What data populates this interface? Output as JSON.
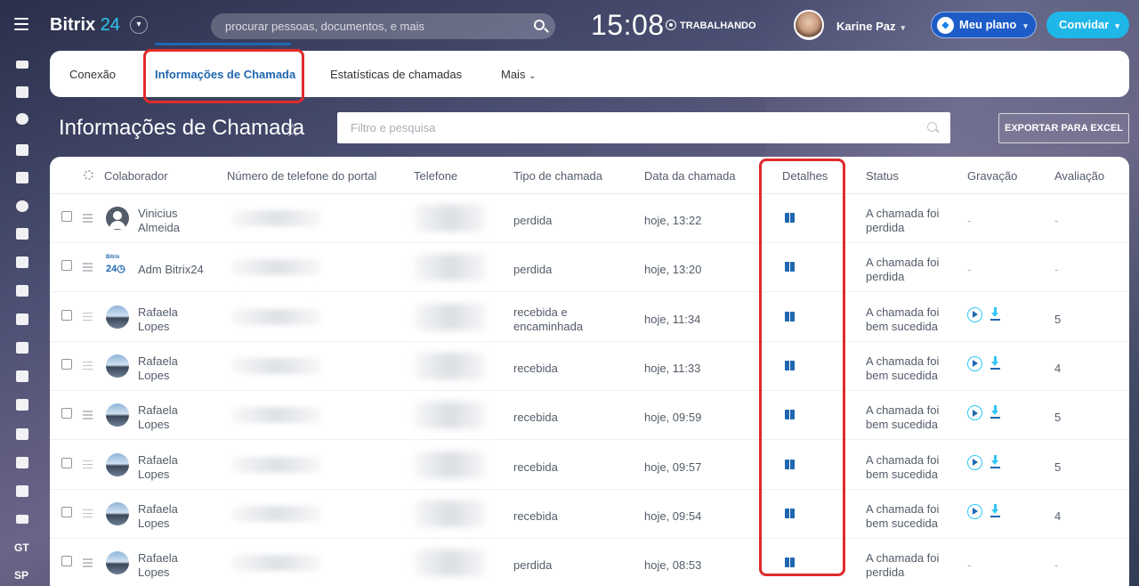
{
  "header": {
    "logo_name": "Bitrix",
    "logo_num": "24",
    "search_placeholder": "procurar pessoas, documentos, e mais",
    "time": "15:08",
    "work_status": "TRABALHANDO",
    "user_name": "Karine Paz",
    "plan_label": "Meu plano",
    "invite_label": "Convidar"
  },
  "sidebar": {
    "text_items": [
      "GT",
      "SP"
    ]
  },
  "tabs": [
    {
      "label": "Conexão",
      "active": false
    },
    {
      "label": "Informações de Chamada",
      "active": true
    },
    {
      "label": "Estatísticas de chamadas",
      "active": false
    },
    {
      "label": "Mais",
      "active": false
    }
  ],
  "page": {
    "title": "Informações de Chamada",
    "filter_placeholder": "Filtro e pesquisa",
    "export_label": "EXPORTAR PARA EXCEL"
  },
  "table": {
    "columns": [
      "Colaborador",
      "Número de telefone do portal",
      "Telefone",
      "Tipo de chamada",
      "Data da chamada",
      "Detalhes",
      "Status",
      "Gravação",
      "Avaliação"
    ],
    "rows": [
      {
        "name": [
          "Vinicius",
          "Almeida"
        ],
        "avatar": "default-user",
        "type": [
          "perdida"
        ],
        "date": "hoje, 13:22",
        "status": [
          "A chamada foi",
          "perdida"
        ],
        "recording": "-",
        "rating": "-"
      },
      {
        "name": [
          "Adm Bitrix24"
        ],
        "avatar": "bitrix-logo",
        "type": [
          "perdida"
        ],
        "date": "hoje, 13:20",
        "status": [
          "A chamada foi",
          "perdida"
        ],
        "recording": "-",
        "rating": "-"
      },
      {
        "name": [
          "Rafaela",
          "Lopes"
        ],
        "avatar": "photo",
        "type": [
          "recebida e",
          "encaminhada"
        ],
        "date": "hoje, 11:34",
        "status": [
          "A chamada foi",
          "bem sucedida"
        ],
        "recording": "play",
        "rating": "5"
      },
      {
        "name": [
          "Rafaela",
          "Lopes"
        ],
        "avatar": "photo",
        "type": [
          "recebida"
        ],
        "date": "hoje, 11:33",
        "status": [
          "A chamada foi",
          "bem sucedida"
        ],
        "recording": "play",
        "rating": "4"
      },
      {
        "name": [
          "Rafaela",
          "Lopes"
        ],
        "avatar": "photo",
        "type": [
          "recebida"
        ],
        "date": "hoje, 09:59",
        "status": [
          "A chamada foi",
          "bem sucedida"
        ],
        "recording": "play",
        "rating": "5"
      },
      {
        "name": [
          "Rafaela",
          "Lopes"
        ],
        "avatar": "photo",
        "type": [
          "recebida"
        ],
        "date": "hoje, 09:57",
        "status": [
          "A chamada foi",
          "bem sucedida"
        ],
        "recording": "play",
        "rating": "5"
      },
      {
        "name": [
          "Rafaela",
          "Lopes"
        ],
        "avatar": "photo",
        "type": [
          "recebida"
        ],
        "date": "hoje, 09:54",
        "status": [
          "A chamada foi",
          "bem sucedida"
        ],
        "recording": "play",
        "rating": "4"
      },
      {
        "name": [
          "Rafaela",
          "Lopes"
        ],
        "avatar": "photo",
        "type": [
          "perdida"
        ],
        "date": "hoje, 08:53",
        "status": [
          "A chamada foi",
          "perdida"
        ],
        "recording": "-",
        "rating": "-"
      }
    ]
  },
  "colors": {
    "accent": "#2067b0",
    "highlight": "#e02b2b",
    "invite": "#1fb6e8",
    "plan": "#1d5cc7"
  }
}
